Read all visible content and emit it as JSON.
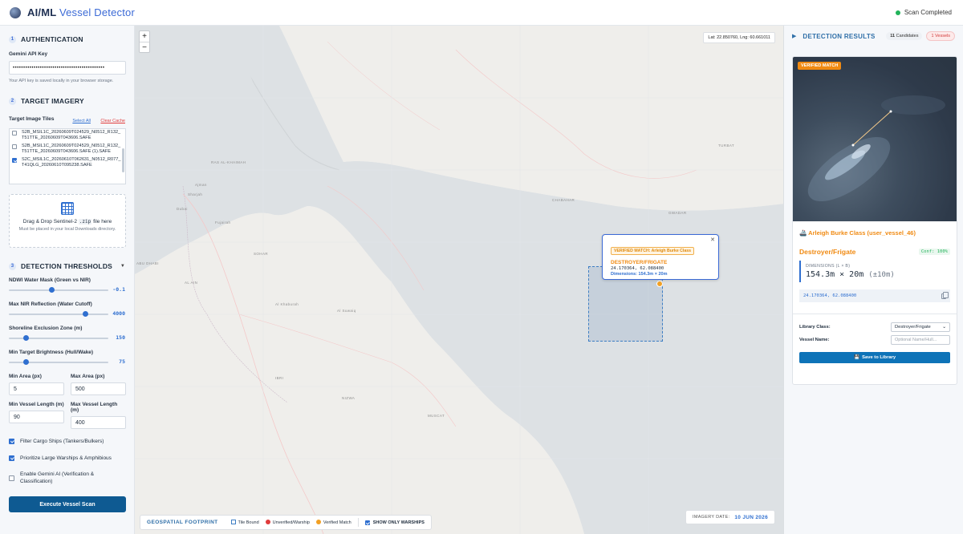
{
  "header": {
    "title_main": "AI/ML",
    "title_accent": "Vessel Detector",
    "status": "Scan Completed"
  },
  "auth": {
    "number": "1",
    "title": "AUTHENTICATION",
    "key_label": "Gemini API Key",
    "key_value": "••••••••••••••••••••••••••••••••••••••••••••",
    "hint": "Your API key is saved locally in your browser storage."
  },
  "imagery": {
    "number": "2",
    "title": "TARGET IMAGERY",
    "tiles_label": "Target Image Tiles",
    "select_all": "Select All",
    "clear_cache": "Clear Cache",
    "files": [
      {
        "name": "S2B_MSIL1C_20260609T024529_N0512_R132_T51TTE_20260609T043606.SAFE",
        "checked": false
      },
      {
        "name": "S2B_MSIL1C_20260609T024529_N0512_R132_T51TTE_20260609T043606.SAFE (1).SAFE",
        "checked": false
      },
      {
        "name": "S2C_MSIL1C_20260610T062631_N0512_R077_T41QLG_20260610T095238.SAFE",
        "checked": true
      }
    ],
    "drop_title_a": "Drag & Drop Sentinel-2",
    "drop_code": ".zip",
    "drop_title_b": "file here",
    "drop_sub": "Must be placed in your local Downloads directory."
  },
  "thresholds": {
    "number": "3",
    "title": "DETECTION THRESHOLDS",
    "sliders": [
      {
        "label": "NDWI Water Mask (Green vs NIR)",
        "value": "-0.1",
        "fraction": 0.42
      },
      {
        "label": "Max NIR Reflection (Water Cutoff)",
        "value": "4000",
        "fraction": 0.78
      },
      {
        "label": "Shoreline Exclusion Zone (m)",
        "value": "150",
        "fraction": 0.15
      },
      {
        "label": "Min Target Brightness (Hull/Wake)",
        "value": "75",
        "fraction": 0.15
      }
    ],
    "min_area_label": "Min Area (px)",
    "min_area": "5",
    "max_area_label": "Max Area (px)",
    "max_area": "500",
    "min_len_label": "Min Vessel Length (m)",
    "min_len": "90",
    "max_len_label": "Max Vessel Length (m)",
    "max_len": "400",
    "checks": [
      {
        "label": "Filter Cargo Ships (Tankers/Bulkers)",
        "checked": true
      },
      {
        "label": "Prioritize Large Warships & Amphibious",
        "checked": true
      },
      {
        "label": "Enable Gemini AI (Verification & Classification)",
        "checked": false
      }
    ],
    "scan_button": "Execute Vessel Scan"
  },
  "map": {
    "zoom_in": "+",
    "zoom_out": "−",
    "coords": "Lat: 22.850760, Lng: 60.661011",
    "places": [
      "RAS AL-KHAIMAH",
      "TURBAT",
      "CHABAHAR",
      "GWADAR",
      "AL AIN",
      "SOHAR",
      "ABU DHABI",
      "NIZWA",
      "IBRI",
      "MUSCAT",
      "Sharjah",
      "Dubai",
      "Al Khaburah",
      "Al Suwaiq",
      "Ajman",
      "Fujairah"
    ],
    "popup": {
      "tag": "VERIFIED MATCH: Arleigh Burke Class",
      "class": "DESTROYER/FRIGATE",
      "coords": "24.170364, 62.088400",
      "dims": "Dimensions: 154.3m × 20m"
    },
    "legend": {
      "title": "GEOSPATIAL FOOTPRINT",
      "tile": "Tile Bound",
      "unverified": "Unverified/Warship",
      "verified": "Verified Match",
      "only_warships": "SHOW ONLY WARSHIPS"
    },
    "imagery_date_label": "IMAGERY DATE:",
    "imagery_date": "10 JUN 2026"
  },
  "results": {
    "title": "DETECTION RESULTS",
    "candidates_count": "11",
    "candidates_label": "Candidates",
    "vessels": "1 Vessels",
    "card": {
      "badge": "VERIFIED MATCH",
      "vessel_name": "Arleigh Burke Class (user_vessel_46)",
      "vessel_class": "Destroyer/Frigate",
      "confidence": "Conf: 100%",
      "dims_label": "DIMENSIONS (L × B)",
      "dims_value": "154.3m × 20m",
      "dims_tol": "(±10m)",
      "coords": "24.170364, 62.088400",
      "library_label": "Library Class:",
      "library_value": "Destroyer/Frigate",
      "vessel_name_label": "Vessel Name:",
      "vessel_name_placeholder": "Optional Name/Hull...",
      "save_button": "Save to Library"
    }
  },
  "colors": {
    "accent": "#2f6fd0",
    "verified": "#f08a12",
    "success": "#22b35a",
    "primary_btn": "#0e5a92",
    "alert": "#e03b3b"
  }
}
